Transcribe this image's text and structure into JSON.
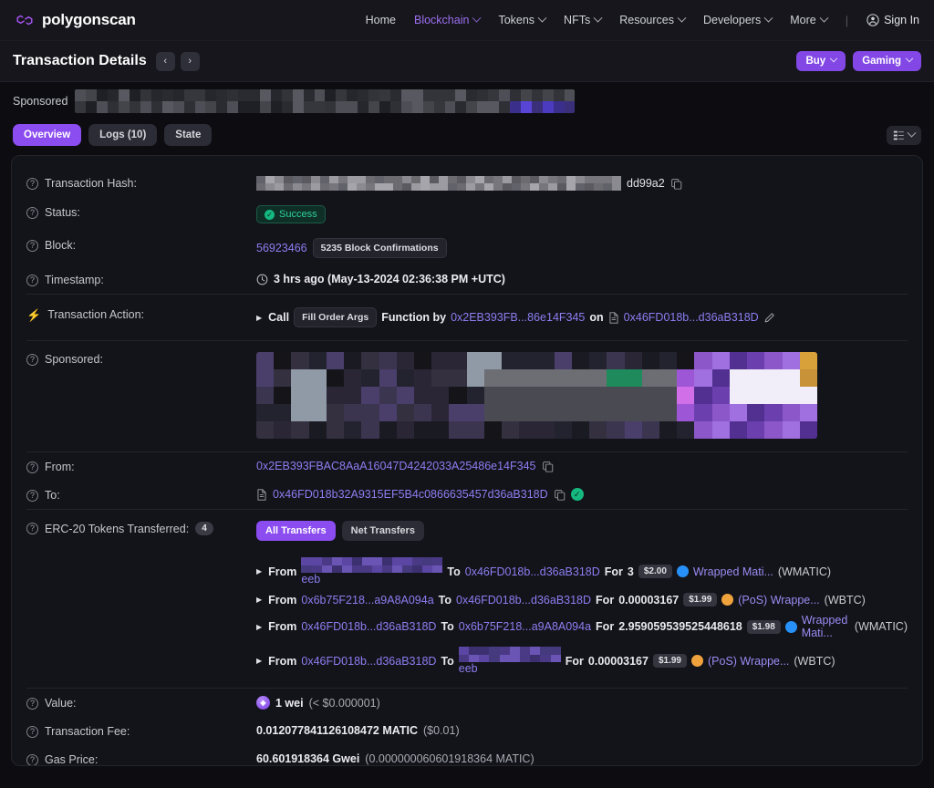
{
  "brand": {
    "name": "polygonscan",
    "logo_icon": "polygon-logo-icon"
  },
  "nav": {
    "items": [
      {
        "label": "Home",
        "has_caret": false,
        "active": false
      },
      {
        "label": "Blockchain",
        "has_caret": true,
        "active": true
      },
      {
        "label": "Tokens",
        "has_caret": true,
        "active": false
      },
      {
        "label": "NFTs",
        "has_caret": true,
        "active": false
      },
      {
        "label": "Resources",
        "has_caret": true,
        "active": false
      },
      {
        "label": "Developers",
        "has_caret": true,
        "active": false
      },
      {
        "label": "More",
        "has_caret": true,
        "active": false
      }
    ],
    "separator": "|",
    "sign_in": "Sign In",
    "sign_in_icon": "user-circle-icon"
  },
  "header": {
    "title": "Transaction Details",
    "prev_icon": "chevron-left-icon",
    "next_icon": "chevron-right-icon",
    "buttons": [
      {
        "label": "Buy",
        "icon": "chevron-down-icon"
      },
      {
        "label": "Gaming",
        "icon": "chevron-down-icon"
      }
    ]
  },
  "sponsored_bar": {
    "label": "Sponsored"
  },
  "tabs": {
    "items": [
      {
        "label": "Overview",
        "active": true
      },
      {
        "label": "Logs (10)",
        "active": false
      },
      {
        "label": "State",
        "active": false
      }
    ],
    "filter_icon": "list-filter-icon",
    "filter_caret_icon": "chevron-down-icon"
  },
  "details": {
    "transaction_hash": {
      "label": "Transaction Hash:",
      "help_icon": "question-circle-icon",
      "value_suffix": "dd99a2",
      "copy_icon": "copy-icon"
    },
    "status": {
      "label": "Status:",
      "help_icon": "question-circle-icon",
      "value": "Success",
      "badge_icon": "check-circle-icon"
    },
    "block": {
      "label": "Block:",
      "help_icon": "question-circle-icon",
      "number": "56923466",
      "confirmations": "5235 Block Confirmations"
    },
    "timestamp": {
      "label": "Timestamp:",
      "help_icon": "question-circle-icon",
      "clock_icon": "clock-icon",
      "value": "3 hrs ago (May-13-2024 02:36:38 PM +UTC)"
    },
    "transaction_action": {
      "label": "Transaction Action:",
      "icon": "lightning-bolt-icon",
      "expand_icon": "triangle-right-icon",
      "call_text": "Call",
      "function_chip": "Fill Order Args",
      "function_by_text": "Function by",
      "caller_address": "0x2EB393FB...86e14F345",
      "on_text": "on",
      "contract_icon": "contract-doc-icon",
      "contract_address": "0x46FD018b...d36aB318D",
      "edit_icon": "pencil-icon"
    },
    "sponsored": {
      "label": "Sponsored:",
      "help_icon": "question-circle-icon"
    },
    "from": {
      "label": "From:",
      "help_icon": "question-circle-icon",
      "address": "0x2EB393FBAC8AaA16047D4242033A25486e14F345",
      "copy_icon": "copy-icon"
    },
    "to": {
      "label": "To:",
      "help_icon": "question-circle-icon",
      "contract_icon": "contract-doc-icon",
      "address": "0x46FD018b32A9315EF5B4c0866635457d36aB318D",
      "copy_icon": "copy-icon",
      "verified_icon": "verified-check-icon"
    },
    "erc20": {
      "label": "ERC-20 Tokens Transferred:",
      "help_icon": "question-circle-icon",
      "count": "4",
      "toggles": [
        {
          "label": "All Transfers",
          "active": true
        },
        {
          "label": "Net Transfers",
          "active": false
        }
      ],
      "transfers": [
        {
          "from_label": "From",
          "from_address": "eeb",
          "from_blurred": true,
          "to_label": "To",
          "to_address": "0x46FD018b...d36aB318D",
          "to_blurred": false,
          "for_label": "For",
          "amount": "3",
          "usd": "$2.00",
          "token_icon": "wmatic-icon",
          "token_color": "#2891f9",
          "token_name": "Wrapped Mati...",
          "token_symbol": "(WMATIC)"
        },
        {
          "from_label": "From",
          "from_address": "0x6b75F218...a9A8A094a",
          "from_blurred": false,
          "to_label": "To",
          "to_address": "0x46FD018b...d36aB318D",
          "to_blurred": false,
          "for_label": "For",
          "amount": "0.00003167",
          "usd": "$1.99",
          "token_icon": "wbtc-icon",
          "token_color": "#f0a33c",
          "token_name": "(PoS) Wrappe...",
          "token_symbol": "(WBTC)"
        },
        {
          "from_label": "From",
          "from_address": "0x46FD018b...d36aB318D",
          "from_blurred": false,
          "to_label": "To",
          "to_address": "0x6b75F218...a9A8A094a",
          "to_blurred": false,
          "for_label": "For",
          "amount": "2.959059539525448618",
          "usd": "$1.98",
          "token_icon": "wmatic-icon",
          "token_color": "#2891f9",
          "token_name": "Wrapped Mati...",
          "token_symbol": "(WMATIC)"
        },
        {
          "from_label": "From",
          "from_address": "0x46FD018b...d36aB318D",
          "from_blurred": false,
          "to_label": "To",
          "to_address": "eeb",
          "to_blurred": true,
          "for_label": "For",
          "amount": "0.00003167",
          "usd": "$1.99",
          "token_icon": "wbtc-icon",
          "token_color": "#f0a33c",
          "token_name": "(PoS) Wrappe...",
          "token_symbol": "(WBTC)"
        }
      ]
    },
    "value": {
      "label": "Value:",
      "help_icon": "question-circle-icon",
      "coin_icon": "matic-coin-icon",
      "amount": "1 wei",
      "fiat": "(< $0.000001)"
    },
    "transaction_fee": {
      "label": "Transaction Fee:",
      "help_icon": "question-circle-icon",
      "amount": "0.012077841126108472 MATIC",
      "fiat": "($0.01)"
    },
    "gas_price": {
      "label": "Gas Price:",
      "help_icon": "question-circle-icon",
      "amount": "60.601918364 Gwei",
      "native": "(0.000000060601918364 MATIC)"
    }
  },
  "colors": {
    "accent": "#8247e5",
    "tab_active": "#8b4cf0",
    "link": "#8b7ff0",
    "success": "#2fcf9e",
    "page_bg": "#0d0d11",
    "card_bg": "#13131a"
  }
}
